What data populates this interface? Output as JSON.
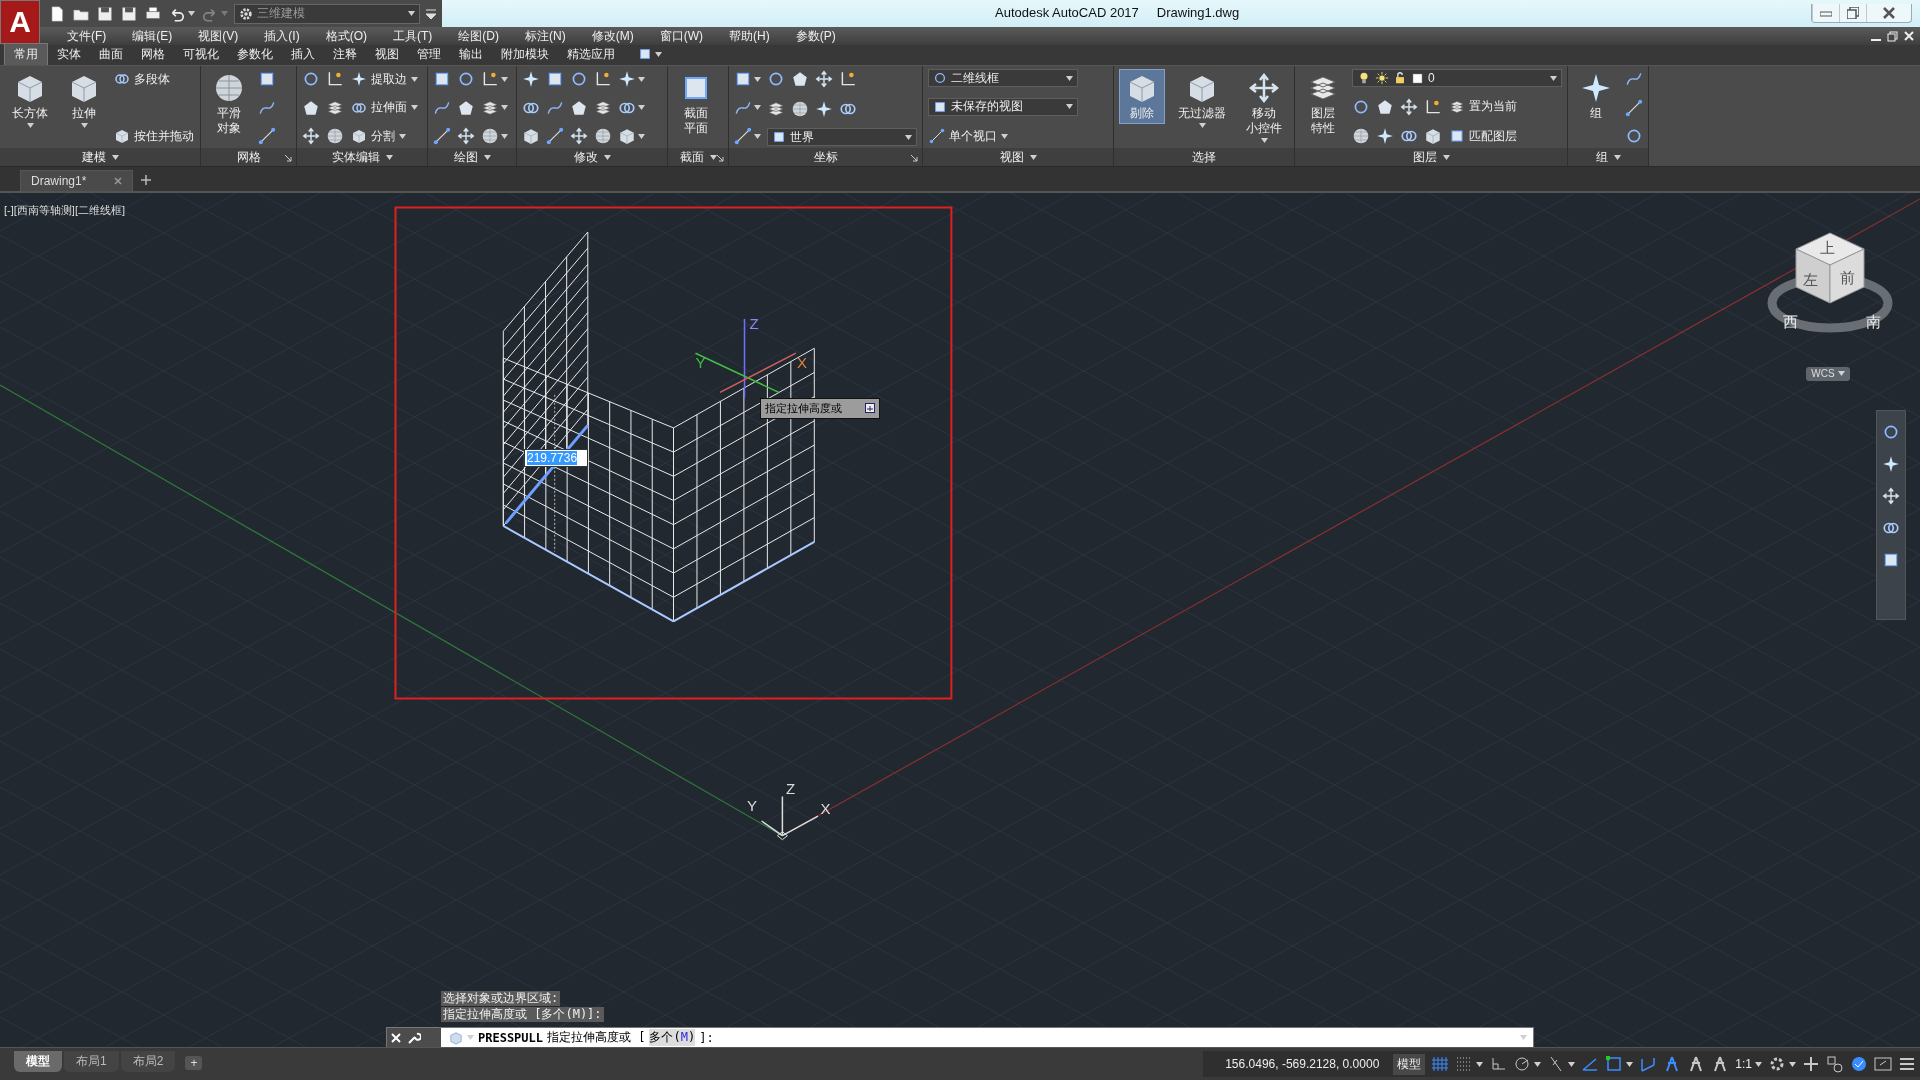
{
  "title_bar": {
    "logo": "A",
    "workspace": "三维建模",
    "app_title": "Autodesk AutoCAD 2017",
    "document": "Drawing1.dwg",
    "quick_access": [
      {
        "caret": false,
        "disabled": false
      },
      {
        "caret": false,
        "disabled": false
      },
      {
        "caret": false,
        "disabled": false
      },
      {
        "caret": false,
        "disabled": false
      },
      {
        "caret": false,
        "disabled": false
      },
      {
        "caret": true,
        "disabled": false
      },
      {
        "caret": true,
        "disabled": true
      }
    ]
  },
  "menu": [
    "文件(F)",
    "编辑(E)",
    "视图(V)",
    "插入(I)",
    "格式(O)",
    "工具(T)",
    "绘图(D)",
    "标注(N)",
    "修改(M)",
    "窗口(W)",
    "帮助(H)",
    "参数(P)"
  ],
  "ribbon_tabs": [
    {
      "label": "常用",
      "selected": true
    },
    {
      "label": "实体",
      "selected": false
    },
    {
      "label": "曲面",
      "selected": false
    },
    {
      "label": "网格",
      "selected": false
    },
    {
      "label": "可视化",
      "selected": false
    },
    {
      "label": "参数化",
      "selected": false
    },
    {
      "label": "插入",
      "selected": false
    },
    {
      "label": "注释",
      "selected": false
    },
    {
      "label": "视图",
      "selected": false
    },
    {
      "label": "管理",
      "selected": false
    },
    {
      "label": "输出",
      "selected": false
    },
    {
      "label": "附加模块",
      "selected": false
    },
    {
      "label": "精选应用",
      "selected": false
    }
  ],
  "ribbon_panels": [
    {
      "title": "建模",
      "menu": true,
      "launcher": false,
      "columns": [
        [
          {
            "kind": "large",
            "lines": [
              "长方体"
            ],
            "caret": true
          }
        ],
        [
          {
            "kind": "large",
            "lines": [
              "拉伸"
            ],
            "caret": true
          }
        ],
        [
          {
            "kind": "small",
            "label": "多段体",
            "caret": false
          },
          {
            "kind": "small",
            "label": "按住并拖动",
            "caret": false
          }
        ]
      ]
    },
    {
      "title": "网格",
      "menu": false,
      "launcher": true,
      "columns": [
        [
          {
            "kind": "large",
            "lines": [
              "平滑",
              "对象"
            ],
            "caret": false
          }
        ],
        [
          {
            "kind": "icon",
            "caret": false
          },
          {
            "kind": "icon",
            "caret": false
          },
          {
            "kind": "icon",
            "caret": false
          }
        ]
      ]
    },
    {
      "title": "实体编辑",
      "menu": true,
      "launcher": false,
      "columns": [
        [
          {
            "kind": "icon",
            "caret": false
          },
          {
            "kind": "icon",
            "caret": false
          },
          {
            "kind": "icon",
            "caret": false
          }
        ],
        [
          {
            "kind": "icon",
            "caret": false
          },
          {
            "kind": "icon",
            "caret": false
          },
          {
            "kind": "icon",
            "caret": false
          }
        ],
        [
          {
            "kind": "small",
            "label": "提取边",
            "caret": true
          },
          {
            "kind": "small",
            "label": "拉伸面",
            "caret": true
          },
          {
            "kind": "small",
            "label": "分割",
            "caret": true
          }
        ]
      ]
    },
    {
      "title": "绘图",
      "menu": true,
      "launcher": false,
      "columns": [
        [
          {
            "kind": "icon",
            "caret": false
          },
          {
            "kind": "icon",
            "caret": false
          },
          {
            "kind": "icon",
            "caret": false
          }
        ],
        [
          {
            "kind": "icon",
            "caret": false
          },
          {
            "kind": "icon",
            "caret": false
          },
          {
            "kind": "icon",
            "caret": false
          }
        ],
        [
          {
            "kind": "icon",
            "caret": true
          },
          {
            "kind": "icon",
            "caret": true
          },
          {
            "kind": "icon",
            "caret": true
          }
        ]
      ]
    },
    {
      "title": "修改",
      "menu": true,
      "launcher": false,
      "columns": [
        [
          {
            "kind": "icon",
            "caret": false
          },
          {
            "kind": "icon",
            "caret": false
          },
          {
            "kind": "icon",
            "caret": false
          }
        ],
        [
          {
            "kind": "icon",
            "caret": false
          },
          {
            "kind": "icon",
            "caret": false
          },
          {
            "kind": "icon",
            "caret": false
          }
        ],
        [
          {
            "kind": "icon",
            "caret": false
          },
          {
            "kind": "icon",
            "caret": false
          },
          {
            "kind": "icon",
            "caret": false
          }
        ],
        [
          {
            "kind": "icon",
            "caret": false
          },
          {
            "kind": "icon",
            "caret": false
          },
          {
            "kind": "icon",
            "caret": false
          }
        ],
        [
          {
            "kind": "icon",
            "caret": true
          },
          {
            "kind": "icon",
            "caret": true
          },
          {
            "kind": "icon",
            "caret": true
          }
        ]
      ]
    },
    {
      "title": "截面",
      "menu": true,
      "launcher": true,
      "columns": [
        [
          {
            "kind": "large",
            "lines": [
              "截面",
              "平面"
            ],
            "caret": false
          }
        ]
      ]
    },
    {
      "title": "坐标",
      "menu": false,
      "launcher": true,
      "columns": [
        [
          {
            "kind": "icon",
            "caret": true
          },
          {
            "kind": "icon",
            "caret": true
          },
          {
            "kind": "icon",
            "caret": true
          }
        ],
        [
          {
            "kind": "row",
            "items": [
              {
                "kind": "icon",
                "caret": false
              },
              {
                "kind": "icon",
                "caret": false
              },
              {
                "kind": "icon",
                "caret": false
              },
              {
                "kind": "icon",
                "caret": false
              }
            ]
          },
          {
            "kind": "row",
            "items": [
              {
                "kind": "icon",
                "caret": false
              },
              {
                "kind": "icon",
                "caret": false
              },
              {
                "kind": "icon",
                "caret": false
              },
              {
                "kind": "icon",
                "caret": false
              }
            ]
          },
          {
            "kind": "combo",
            "value": "世界"
          }
        ]
      ]
    },
    {
      "title": "视图",
      "menu": true,
      "launcher": false,
      "columns": [
        [
          {
            "kind": "combo",
            "value": "二维线框"
          },
          {
            "kind": "combo",
            "value": "未保存的视图"
          },
          {
            "kind": "small",
            "label": "单个视口",
            "caret": true
          }
        ]
      ]
    },
    {
      "title": "选择",
      "menu": false,
      "launcher": false,
      "columns": [
        [
          {
            "kind": "large",
            "lines": [
              "剔除"
            ],
            "caret": false,
            "on": true
          }
        ],
        [
          {
            "kind": "large",
            "lines": [
              "无过滤器"
            ],
            "caret": true,
            "on": false
          }
        ],
        [
          {
            "kind": "large",
            "lines": [
              "移动",
              "小控件"
            ],
            "caret": true,
            "on": false
          }
        ]
      ]
    },
    {
      "title": "图层",
      "menu": true,
      "launcher": false,
      "columns": [
        [
          {
            "kind": "large",
            "lines": [
              "图层",
              "特性"
            ],
            "caret": false
          }
        ],
        [
          {
            "kind": "layercombo",
            "value": "0"
          },
          {
            "kind": "row",
            "items": [
              {
                "kind": "icon",
                "caret": false
              },
              {
                "kind": "icon",
                "caret": false
              },
              {
                "kind": "icon",
                "caret": false
              },
              {
                "kind": "icon",
                "caret": false
              },
              {
                "kind": "small",
                "label": "置为当前",
                "caret": false
              }
            ]
          },
          {
            "kind": "row",
            "items": [
              {
                "kind": "icon",
                "caret": false
              },
              {
                "kind": "icon",
                "caret": false
              },
              {
                "kind": "icon",
                "caret": false
              },
              {
                "kind": "icon",
                "caret": false
              },
              {
                "kind": "small",
                "label": "匹配图层",
                "caret": false
              }
            ]
          }
        ]
      ]
    },
    {
      "title": "组",
      "menu": true,
      "launcher": false,
      "columns": [
        [
          {
            "kind": "large",
            "lines": [
              "组"
            ],
            "caret": false
          }
        ],
        [
          {
            "kind": "icon",
            "caret": false
          },
          {
            "kind": "icon",
            "caret": false
          },
          {
            "kind": "icon",
            "caret": false
          }
        ]
      ]
    }
  ],
  "file_tabs": [
    {
      "label": "Drawing1*",
      "selected": true
    }
  ],
  "viewport": {
    "label": "[-][西南等轴测][二维线框]",
    "cursor_axes": {
      "z": "Z",
      "y": "Y",
      "x": "X"
    },
    "dynamic_input": "219.7736",
    "tooltip": "指定拉伸高度或",
    "world_axes": {
      "z": "Z",
      "y": "Y",
      "x": "X"
    },
    "viewcube": {
      "top": "上",
      "left": "左",
      "front": "前",
      "west": "西",
      "south": "南",
      "wcs": "WCS"
    }
  },
  "command_history": [
    "选择对象或边界区域:",
    "指定拉伸高度或 [多个(M)]:"
  ],
  "command_line": {
    "command": "PRESSPULL",
    "prompt": "指定拉伸高度或 [",
    "option_text": "多个(",
    "option_key": "M",
    "option_close": ")",
    "prompt_end": "]:"
  },
  "layout_tabs": [
    {
      "label": "模型",
      "selected": true
    },
    {
      "label": "布局1",
      "selected": false
    },
    {
      "label": "布局2",
      "selected": false
    }
  ],
  "add_tab": "+",
  "status_bar": {
    "coordinates": "156.0496, -569.2128, 0.0000",
    "space": "模型",
    "toggles": [
      {
        "on": true,
        "caret": false
      },
      {
        "on": false,
        "caret": true
      },
      {
        "on": false,
        "caret": false
      },
      {
        "on": false,
        "caret": true
      },
      {
        "on": false,
        "caret": true
      },
      {
        "on": true,
        "caret": false
      },
      {
        "on": true,
        "caret": true
      },
      {
        "on": true,
        "caret": false
      },
      {
        "on": true,
        "caret": false
      },
      {
        "on": false,
        "caret": false
      },
      {
        "on": false,
        "caret": false
      }
    ],
    "scale": "1:1",
    "tools": [
      {
        "on": false,
        "caret": true
      },
      {
        "on": false,
        "caret": false
      },
      {
        "on": false,
        "caret": false
      },
      {
        "on": true,
        "caret": false
      },
      {
        "on": false,
        "caret": false
      },
      {
        "on": false,
        "caret": false
      }
    ]
  }
}
